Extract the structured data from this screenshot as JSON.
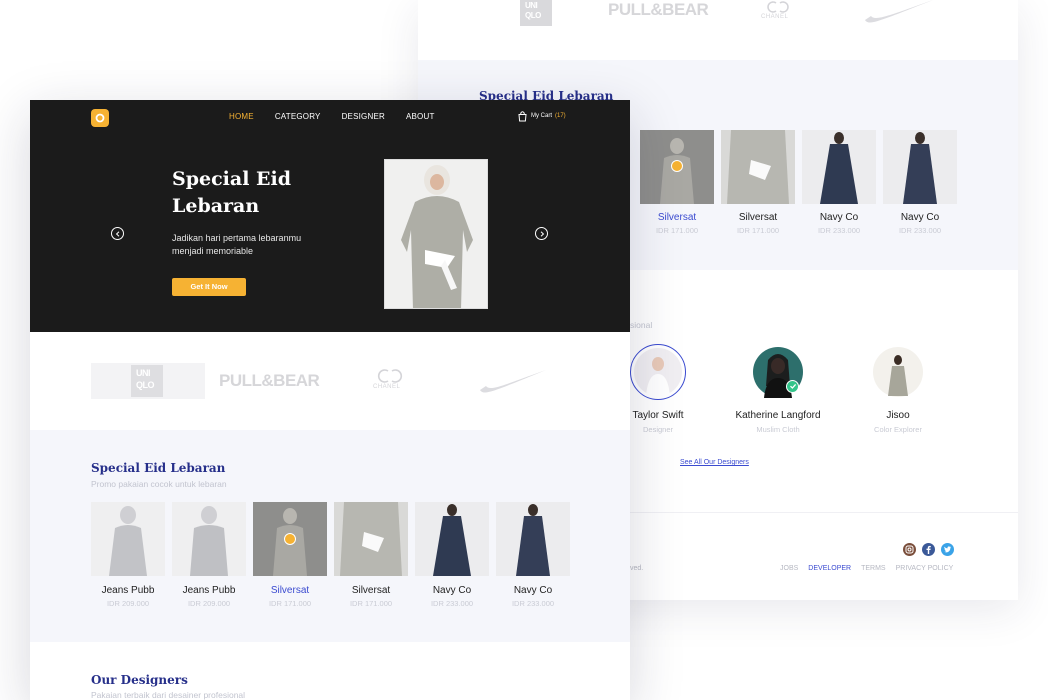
{
  "nav": {
    "items": [
      {
        "label": "HOME",
        "active": true
      },
      {
        "label": "CATEGORY",
        "active": false
      },
      {
        "label": "DESIGNER",
        "active": false
      },
      {
        "label": "ABOUT",
        "active": false
      }
    ],
    "cart_label": "My Cart",
    "cart_count": "(17)"
  },
  "hero": {
    "title_line1": "Special Eid",
    "title_line2": "Lebaran",
    "subtitle_line1": "Jadikan hari pertama lebaranmu",
    "subtitle_line2": "menjadi memoriable",
    "cta": "Get It Now"
  },
  "brands": {
    "uniqlo_top": "UNI",
    "uniqlo_bottom": "QLO",
    "pullbear": "PULL&BEAR",
    "chanel": "CHANEL"
  },
  "special": {
    "title": "Special Eid Lebaran",
    "subtitle": "Promo pakaian cocok untuk lebaran",
    "products": [
      {
        "name": "Jeans Pubb",
        "price": "IDR 209.000",
        "selected": false
      },
      {
        "name": "Jeans Pubb",
        "price": "IDR 209.000",
        "selected": false
      },
      {
        "name": "Silversat",
        "price": "IDR 171.000",
        "selected": true
      },
      {
        "name": "Silversat",
        "price": "IDR 171.000",
        "selected": false
      },
      {
        "name": "Navy Co",
        "price": "IDR 233.000",
        "selected": false
      },
      {
        "name": "Navy Co",
        "price": "IDR 233.000",
        "selected": false
      }
    ]
  },
  "designers": {
    "title": "Our Designers",
    "subtitle": "Pakaian terbaik dari desainer profesional",
    "subtitle_fragment": "sional",
    "items": [
      {
        "name": "Taylor Swift",
        "role": "Designer"
      },
      {
        "name": "Katherine Langford",
        "role": "Muslim Cloth"
      },
      {
        "name": "Jisoo",
        "role": "Color Explorer"
      }
    ],
    "see_all": "See All Our Designers"
  },
  "footer": {
    "copyright_fragment": "ved.",
    "links": [
      {
        "label": "JOBS",
        "active": false
      },
      {
        "label": "DEVELOPER",
        "active": true
      },
      {
        "label": "TERMS",
        "active": false
      },
      {
        "label": "PRIVACY POLICY",
        "active": false
      }
    ]
  },
  "colors": {
    "accent": "#f6b233",
    "brand_blue": "#262f8a",
    "link_blue": "#3b4bd0",
    "hero_bg": "#1b1b1b",
    "section_bg": "#f5f6fb"
  }
}
